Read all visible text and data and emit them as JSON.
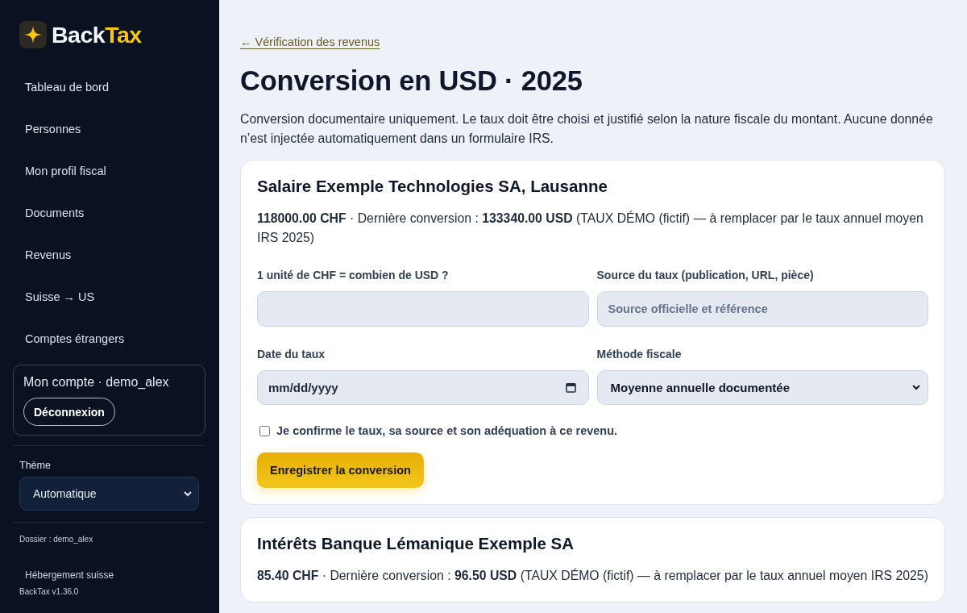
{
  "sidebar": {
    "brand": {
      "primary": "Back",
      "accent": "Tax"
    },
    "nav_items": [
      {
        "label": "Tableau de bord",
        "selected": false
      },
      {
        "label": "Personnes",
        "selected": false
      },
      {
        "label": "Mon profil fiscal",
        "selected": false
      },
      {
        "label": "Documents",
        "selected": false
      },
      {
        "label": "Revenus",
        "selected": false
      },
      {
        "label": "Suisse → US",
        "selected": false
      },
      {
        "label": "Comptes étrangers",
        "selected": false
      }
    ],
    "account": {
      "label": "Mon compte · demo_alex",
      "logout_button": "Déconnexion"
    },
    "theme": {
      "label": "Thème",
      "value": "Automatique"
    },
    "folder": "Dossier : demo_alex",
    "hosting": "Hébergement suisse",
    "version": "BackTax v1.36.0"
  },
  "main": {
    "back_link": "← Vérification des revenus",
    "title": "Conversion en USD · 2025",
    "intro": "Conversion documentaire uniquement. Le taux doit être choisi et justifié selon la nature fiscale du montant. Aucune donnée n’est injectée automatiquement dans un formulaire IRS.",
    "cards": [
      {
        "title": "Salaire Exemple Technologies SA, Lausanne",
        "summary": "**118000.00 CHF** · Dernière conversion : **133340.00 USD** (TAUX DÉMO (fictif) — à remplacer par le taux annuel moyen IRS 2025)",
        "form": {
          "fields": [
            {
              "kind": "text",
              "label": "1 unité de CHF = combien de USD ?"
            },
            {
              "kind": "text",
              "label": "Source du taux (publication, URL, pièce)",
              "placeholder": "Source officielle et référence"
            },
            {
              "kind": "date",
              "label": "Date du taux",
              "placeholder": "mm/dd/yyyy"
            },
            {
              "kind": "select",
              "label": "Méthode fiscale",
              "value": "Moyenne annuelle documentée"
            }
          ],
          "confirm": {
            "label": "Je confirme le taux, sa source et son adéquation à ce revenu.",
            "checked": false
          },
          "submit_button": "Enregistrer la conversion"
        }
      },
      {
        "title": "Intérêts Banque Lémanique Exemple SA",
        "summary": "**85.40 CHF** · Dernière conversion : **96.50 USD** (TAUX DÉMO (fictif) — à remplacer par le taux annuel moyen IRS 2025)"
      }
    ]
  }
}
